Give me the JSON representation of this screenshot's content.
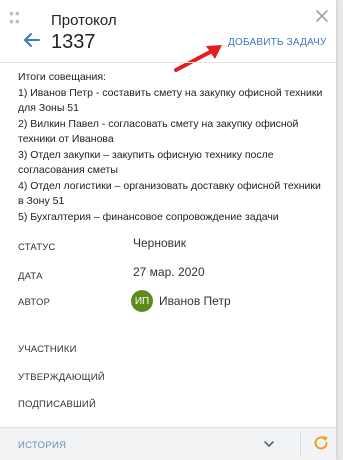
{
  "header": {
    "title": "Протокол",
    "number": "1337",
    "add_task_label": "ДОБАВИТЬ ЗАДАЧУ"
  },
  "notes": [
    "Итоги совещания:",
    "1) Иванов Петр - составить смету на закупку офисной техники для Зоны 51",
    "2) Вилкин Павел - согласовать смету на закупку офисной техники от Иванова",
    "3) Отдел закупки – закупить офисную технику после согласования сметы",
    "4) Отдел логистики – организовать доставку офисной техники в Зону 51",
    "5) Бухгалтерия – финансовое сопровождение задачи"
  ],
  "fields": {
    "status_label": "СТАТУС",
    "status_value": "Черновик",
    "date_label": "ДАТА",
    "date_value": "27 мар. 2020",
    "author_label": "АВТОР",
    "author_initials": "ИП",
    "author_name": "Иванов Петр",
    "participants_label": "УЧАСТНИКИ",
    "approver_label": "УТВЕРЖДАЮЩИЙ",
    "signer_label": "ПОДПИСАВШИЙ"
  },
  "footer": {
    "history_label": "ИСТОРИЯ"
  },
  "colors": {
    "accent": "#3b78c4",
    "avatar": "#5f8a1b",
    "refresh": "#f0a020",
    "annotation_arrow": "#e0201e"
  },
  "icons": {
    "drag": "drag-handle-icon",
    "close": "close-icon",
    "back": "arrow-left-icon",
    "chevron": "chevron-down-icon",
    "refresh": "refresh-icon"
  }
}
